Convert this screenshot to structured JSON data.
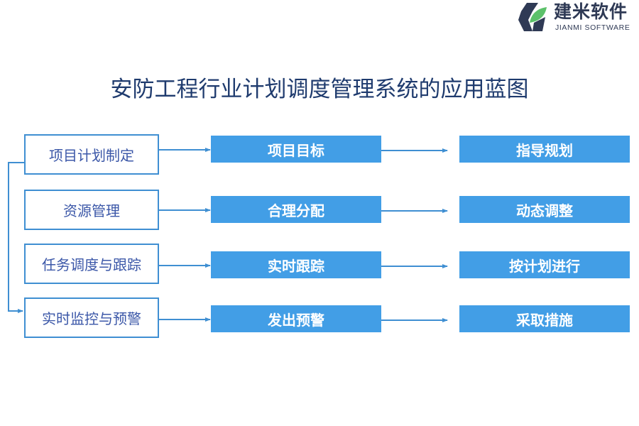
{
  "logo": {
    "name_cn": "建米软件",
    "name_en": "JIANMI SOFTWARE",
    "colors": {
      "dark": "#2f3a55",
      "green": "#5cc16a"
    }
  },
  "title": "安防工程行业计划调度管理系统的应用蓝图",
  "colors": {
    "line": "#3f8fd2",
    "box_fill": "#429ee6",
    "left_text": "#3b57a8",
    "title": "#1f3b6e"
  },
  "rows": [
    {
      "stage": "项目计划制定",
      "action": "项目目标",
      "outcome": "指导规划"
    },
    {
      "stage": "资源管理",
      "action": "合理分配",
      "outcome": "动态调整"
    },
    {
      "stage": "任务调度与跟踪",
      "action": "实时跟踪",
      "outcome": "按计划进行"
    },
    {
      "stage": "实时监控与预警",
      "action": "发出预警",
      "outcome": "采取措施"
    }
  ]
}
